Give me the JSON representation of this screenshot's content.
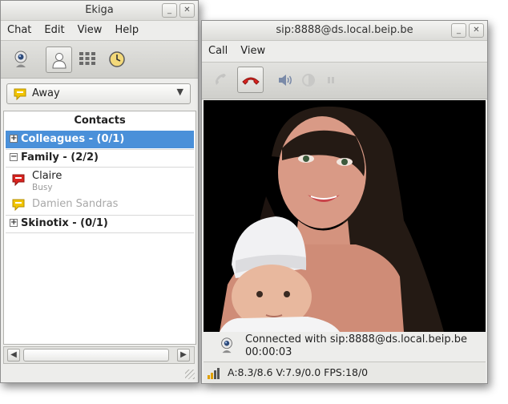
{
  "left_window": {
    "title": "Ekiga",
    "menu": [
      "Chat",
      "Edit",
      "View",
      "Help"
    ],
    "toolbar": [
      {
        "icon": "webcam-icon"
      },
      {
        "icon": "contacts-icon",
        "active": true
      },
      {
        "icon": "dialpad-icon"
      },
      {
        "icon": "call-history-icon"
      }
    ],
    "status": {
      "label": "Away",
      "icon": "away-bubble-icon",
      "color": "#f2c500"
    },
    "contacts": {
      "header": "Contacts",
      "groups": [
        {
          "name": "Colleagues - (0/1)",
          "expanded": false,
          "selected": true
        },
        {
          "name": "Family - (2/2)",
          "expanded": true,
          "selected": false
        },
        {
          "name": "Skinotix - (0/1)",
          "expanded": false,
          "selected": false
        }
      ],
      "members": [
        {
          "name": "Claire",
          "status": "Busy",
          "icon": "busy-bubble-icon",
          "color": "#d9231f"
        },
        {
          "name": "Damien Sandras",
          "status": "",
          "icon": "away-bubble-icon",
          "color": "#f2c500"
        }
      ]
    }
  },
  "right_window": {
    "title": "sip:8888@ds.local.beip.be",
    "menu": [
      "Call",
      "View"
    ],
    "toolbar": [
      {
        "icon": "pickup-phone-icon",
        "enabled": false
      },
      {
        "icon": "hangup-phone-icon",
        "enabled": true,
        "active": true
      },
      {
        "icon": "volume-icon",
        "enabled": true
      },
      {
        "icon": "video-settings-icon",
        "enabled": false
      },
      {
        "icon": "pause-icon",
        "enabled": false
      }
    ],
    "call_status": "Connected with sip:8888@ds.local.beip.be",
    "call_duration": "00:00:03",
    "stats": "A:8.3/8.6 V:7.9/0.0 FPS:18/0"
  },
  "colors": {
    "selection": "#4a90d9",
    "hangup_red": "#d9231f",
    "window_bg": "#ededeb"
  }
}
